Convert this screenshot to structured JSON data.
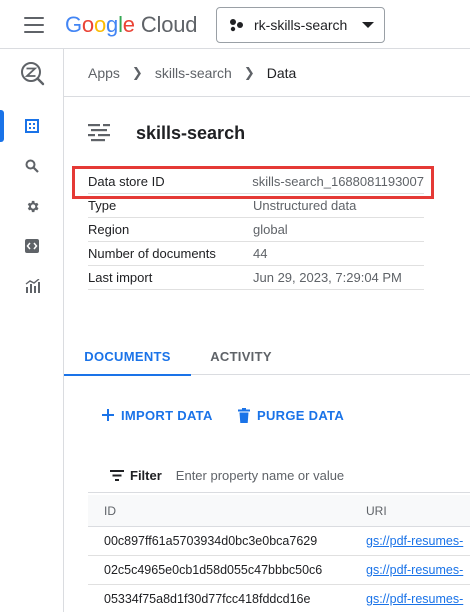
{
  "app": {
    "logo": {
      "g1": "G",
      "g2": "o",
      "g3": "o",
      "g4": "g",
      "g5": "l",
      "g6": "e",
      "cloud": "Cloud"
    },
    "project_picker": {
      "label": "rk-skills-search"
    }
  },
  "breadcrumb": {
    "items": [
      "Apps",
      "skills-search",
      "Data"
    ]
  },
  "page": {
    "title": "skills-search"
  },
  "details": [
    {
      "key": "Data store ID",
      "value": "skills-search_1688081193007"
    },
    {
      "key": "Type",
      "value": "Unstructured data"
    },
    {
      "key": "Region",
      "value": "global"
    },
    {
      "key": "Number of documents",
      "value": "44"
    },
    {
      "key": "Last import",
      "value": "Jun 29, 2023, 7:29:04 PM"
    }
  ],
  "tabs": [
    {
      "label": "DOCUMENTS",
      "selected": true
    },
    {
      "label": "ACTIVITY",
      "selected": false
    }
  ],
  "actions": {
    "import_label": "IMPORT DATA",
    "purge_label": "PURGE DATA"
  },
  "filter": {
    "label": "Filter",
    "placeholder": "Enter property name or value"
  },
  "table": {
    "headers": {
      "id": "ID",
      "uri": "URI"
    },
    "rows": [
      {
        "id": "00c897ff61a5703934d0bc3e0bca7629",
        "uri": "gs://pdf-resumes-"
      },
      {
        "id": "02c5c4965e0cb1d58d055c47bbbc50c6",
        "uri": "gs://pdf-resumes-"
      },
      {
        "id": "05334f75a8d1f30d77fcc418fddcd16e",
        "uri": "gs://pdf-resumes-"
      }
    ]
  },
  "colors": {
    "accent": "#1a73e8",
    "highlight_border": "#e53935"
  },
  "icons": {
    "nav": [
      "search-integration-icon",
      "dashboard-icon",
      "search-icon",
      "gear-icon",
      "code-icon",
      "analytics-icon"
    ]
  }
}
